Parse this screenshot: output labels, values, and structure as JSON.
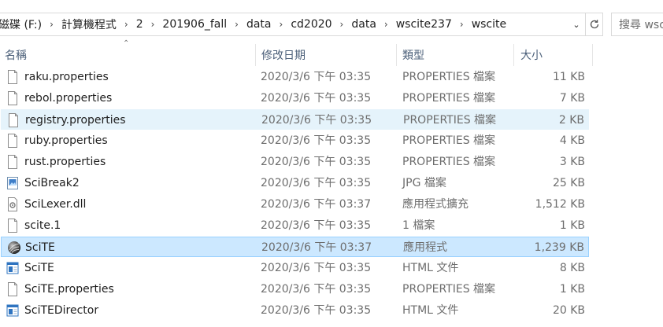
{
  "address": {
    "crumbs": [
      "磁碟 (F:)",
      "計算機程式",
      "2",
      "201906_fall",
      "data",
      "cd2020",
      "data",
      "wscite237",
      "wscite"
    ]
  },
  "search": {
    "placeholder": "搜尋 wscite"
  },
  "columns": {
    "name": "名稱",
    "date": "修改日期",
    "type": "類型",
    "size": "大小"
  },
  "files": [
    {
      "name": "raku.properties",
      "date": "2020/3/6 下午 03:35",
      "type": "PROPERTIES 檔案",
      "size": "11 KB",
      "icon": "document-icon",
      "state": ""
    },
    {
      "name": "rebol.properties",
      "date": "2020/3/6 下午 03:35",
      "type": "PROPERTIES 檔案",
      "size": "7 KB",
      "icon": "document-icon",
      "state": ""
    },
    {
      "name": "registry.properties",
      "date": "2020/3/6 下午 03:35",
      "type": "PROPERTIES 檔案",
      "size": "2 KB",
      "icon": "document-icon",
      "state": "hover"
    },
    {
      "name": "ruby.properties",
      "date": "2020/3/6 下午 03:35",
      "type": "PROPERTIES 檔案",
      "size": "4 KB",
      "icon": "document-icon",
      "state": ""
    },
    {
      "name": "rust.properties",
      "date": "2020/3/6 下午 03:35",
      "type": "PROPERTIES 檔案",
      "size": "3 KB",
      "icon": "document-icon",
      "state": ""
    },
    {
      "name": "SciBreak2",
      "date": "2020/3/6 下午 03:35",
      "type": "JPG 檔案",
      "size": "25 KB",
      "icon": "image-icon",
      "state": ""
    },
    {
      "name": "SciLexer.dll",
      "date": "2020/3/6 下午 03:37",
      "type": "應用程式擴充",
      "size": "1,512 KB",
      "icon": "dll-icon",
      "state": ""
    },
    {
      "name": "scite.1",
      "date": "2020/3/6 下午 03:35",
      "type": "1 檔案",
      "size": "1 KB",
      "icon": "document-icon",
      "state": ""
    },
    {
      "name": "SciTE",
      "date": "2020/3/6 下午 03:37",
      "type": "應用程式",
      "size": "1,239 KB",
      "icon": "scite-app-icon",
      "state": "selected"
    },
    {
      "name": "SciTE",
      "date": "2020/3/6 下午 03:35",
      "type": "HTML 文件",
      "size": "8 KB",
      "icon": "html-icon",
      "state": ""
    },
    {
      "name": "SciTE.properties",
      "date": "2020/3/6 下午 03:35",
      "type": "PROPERTIES 檔案",
      "size": "1 KB",
      "icon": "document-icon",
      "state": ""
    },
    {
      "name": "SciTEDirector",
      "date": "2020/3/6 下午 03:35",
      "type": "HTML 文件",
      "size": "20 KB",
      "icon": "html-icon",
      "state": ""
    }
  ]
}
